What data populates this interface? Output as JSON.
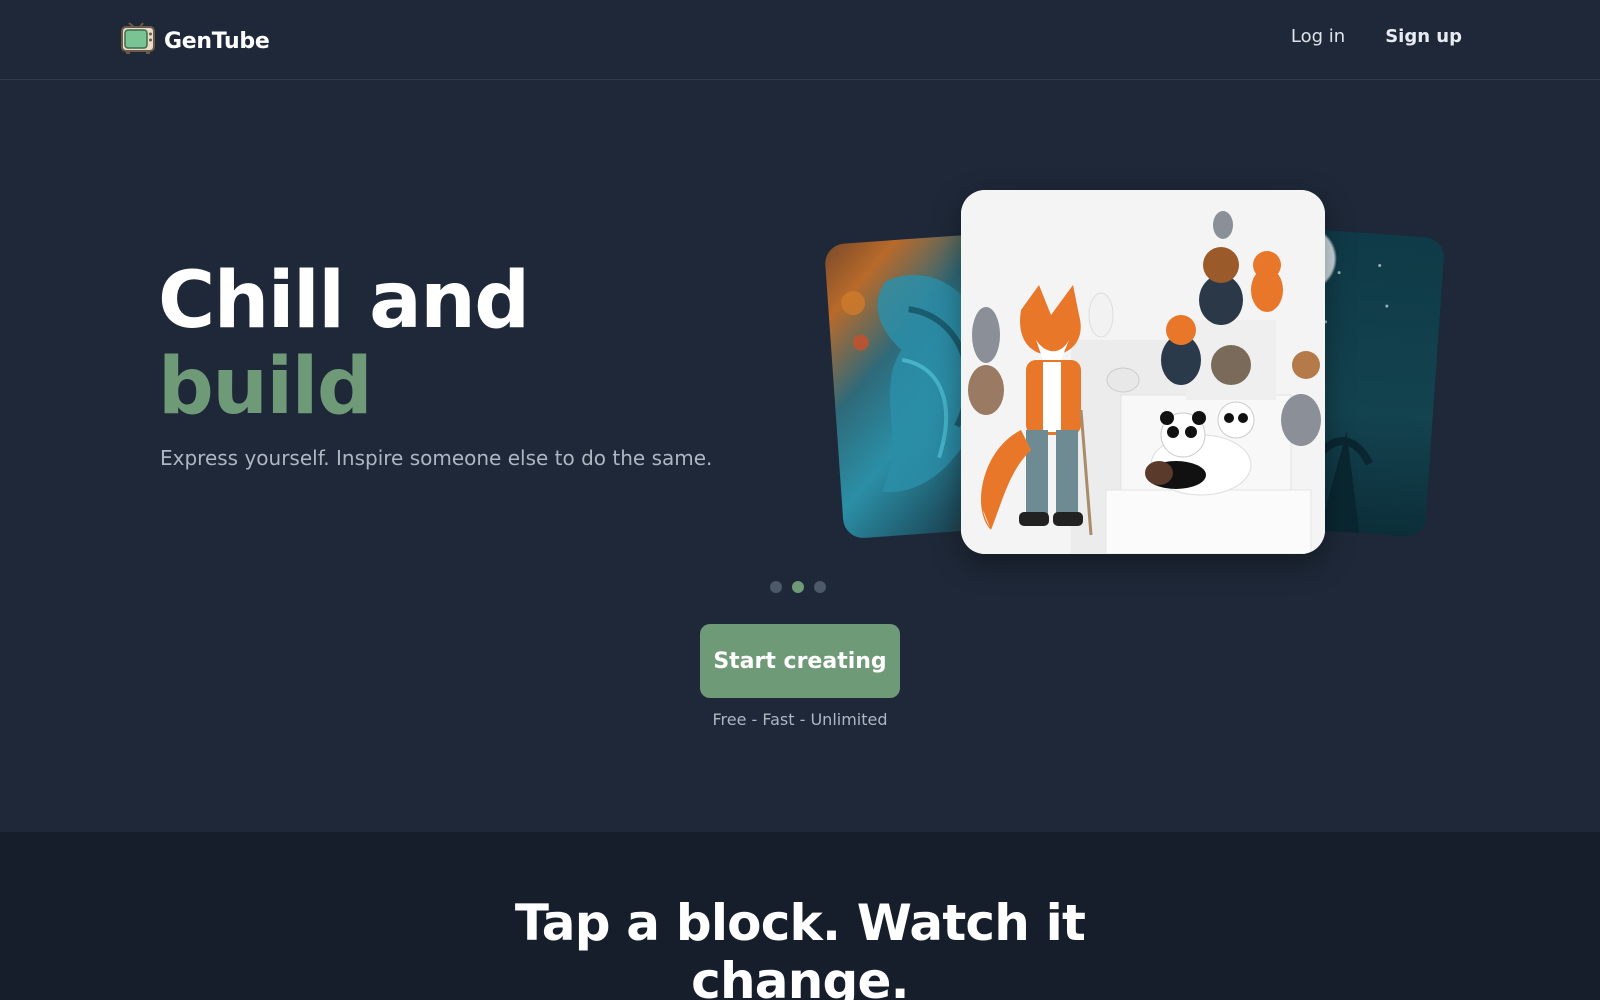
{
  "header": {
    "brand": "GenTube",
    "brand_icon": "tv-icon",
    "login_label": "Log in",
    "signup_label": "Sign up"
  },
  "hero": {
    "title_line1": "Chill and",
    "title_line2": "build",
    "subtitle": "Express yourself. Inspire someone else to do the same.",
    "cta_label": "Start creating",
    "cta_note": "Free - Fast - Unlimited",
    "carousel": {
      "slide_count": 3,
      "active_index": 1
    }
  },
  "section2": {
    "title": "Tap a block. Watch it change."
  },
  "colors": {
    "background": "#1e2838",
    "accent": "#6f9a78",
    "section2_background": "#161e2b",
    "muted_text": "#aeb6c2"
  }
}
